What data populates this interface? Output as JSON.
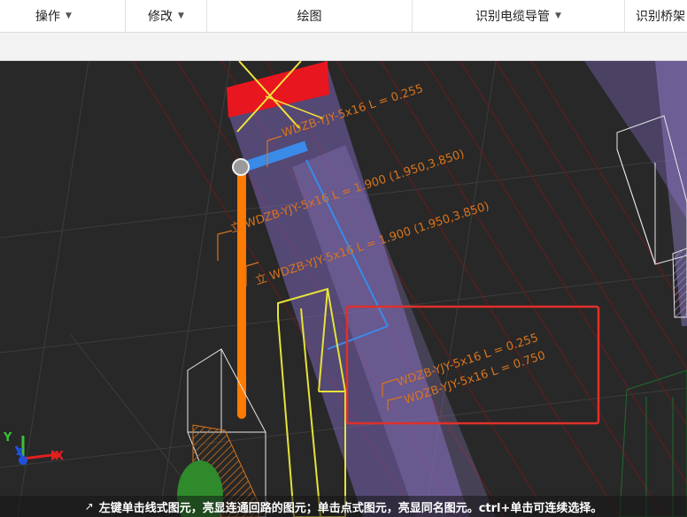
{
  "toolbar": {
    "menus": [
      {
        "label": "操作",
        "has_dropdown": true
      },
      {
        "label": "修改",
        "has_dropdown": true
      },
      {
        "label": "绘图",
        "has_dropdown": false
      },
      {
        "label": "识别电缆导管",
        "has_dropdown": true
      },
      {
        "label": "识别桥架",
        "has_dropdown": false
      }
    ]
  },
  "viewport": {
    "labels": {
      "top_cable": "WDZB-YJY-5x16 L = 0.255",
      "riser_1": "立 WDZB-YJY-5x16 L = 1.900 (1.950,3.850)",
      "riser_2": "立 WDZB-YJY-5x16 L = 1.900 (1.950,3.850)",
      "selected_1": "WDZB-YJY-5x16 L = 0.255",
      "selected_2": "WDZB-YJY-5x16 L = 0.750"
    },
    "axis": {
      "x": "X",
      "y": "Y",
      "z": "Z"
    },
    "colors": {
      "annotation": "#d8741e",
      "highlight_box": "#e0302a",
      "selected_pipe": "#3a8ae8",
      "riser_pipe": "#ff7a00",
      "tray": "#8a6fd0"
    }
  },
  "statusbar": {
    "icon": "cursor-arrow-icon",
    "text": "左键单击线式图元，亮显连通回路的图元；单击点式图元，亮显同名图元。ctrl+单击可连续选择。"
  }
}
